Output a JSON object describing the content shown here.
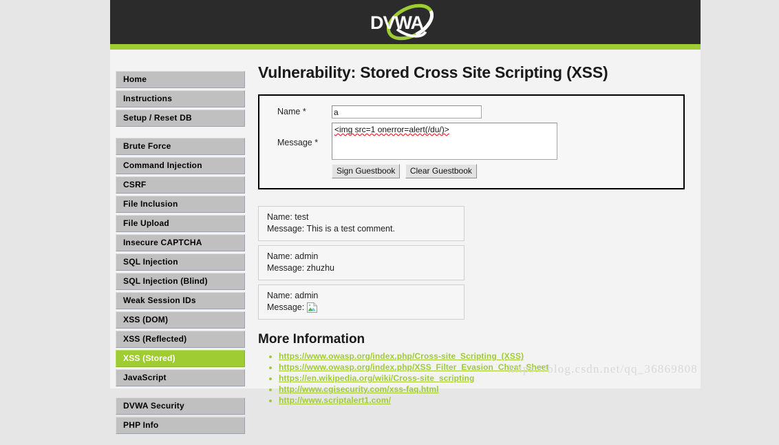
{
  "header": {
    "logo_text": "DVWA",
    "logo_alt": "dvwa-logo"
  },
  "sidebar": {
    "groups": [
      {
        "items": [
          {
            "label": "Home",
            "active": false
          },
          {
            "label": "Instructions",
            "active": false
          },
          {
            "label": "Setup / Reset DB",
            "active": false
          }
        ]
      },
      {
        "items": [
          {
            "label": "Brute Force",
            "active": false
          },
          {
            "label": "Command Injection",
            "active": false
          },
          {
            "label": "CSRF",
            "active": false
          },
          {
            "label": "File Inclusion",
            "active": false
          },
          {
            "label": "File Upload",
            "active": false
          },
          {
            "label": "Insecure CAPTCHA",
            "active": false
          },
          {
            "label": "SQL Injection",
            "active": false
          },
          {
            "label": "SQL Injection (Blind)",
            "active": false
          },
          {
            "label": "Weak Session IDs",
            "active": false
          },
          {
            "label": "XSS (DOM)",
            "active": false
          },
          {
            "label": "XSS (Reflected)",
            "active": false
          },
          {
            "label": "XSS (Stored)",
            "active": true
          },
          {
            "label": "JavaScript",
            "active": false
          }
        ]
      },
      {
        "items": [
          {
            "label": "DVWA Security",
            "active": false
          },
          {
            "label": "PHP Info",
            "active": false
          }
        ]
      }
    ]
  },
  "main": {
    "page_title": "Vulnerability: Stored Cross Site Scripting (XSS)",
    "form": {
      "name_label": "Name *",
      "name_value": "a",
      "message_label": "Message *",
      "message_value": "<img src=1 onerror=alert(/du/)>",
      "sign_button": "Sign Guestbook",
      "clear_button": "Clear Guestbook"
    },
    "guestbook": [
      {
        "name_line": "Name: test",
        "message_prefix": "Message: This is a test comment.",
        "has_broken_image": false
      },
      {
        "name_line": "Name: admin",
        "message_prefix": "Message: zhuzhu",
        "has_broken_image": false
      },
      {
        "name_line": "Name: admin",
        "message_prefix": "Message:",
        "has_broken_image": true,
        "broken_image_icon": "broken-image-icon"
      }
    ],
    "more_information": {
      "title": "More Information",
      "links": [
        "https://www.owasp.org/index.php/Cross-site_Scripting_(XSS)",
        "https://www.owasp.org/index.php/XSS_Filter_Evasion_Cheat_Sheet",
        "https://en.wikipedia.org/wiki/Cross-site_scripting",
        "http://www.cgisecurity.com/xss-faq.html",
        "http://www.scriptalert1.com/"
      ]
    }
  },
  "watermark": {
    "text": "https://blog.csdn.net/qq_36869808"
  },
  "colors": {
    "accent_green": "#9fcc33",
    "header_dark": "#2b2b2b",
    "page_bg": "#f3f3f3",
    "outer_bg": "#e6e6e6",
    "nav_item_bg": "#c0c0c0"
  }
}
